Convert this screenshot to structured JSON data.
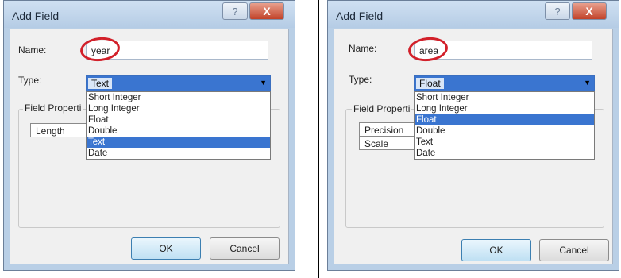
{
  "dialogs": [
    {
      "title": "Add Field",
      "help_glyph": "?",
      "close_glyph": "X",
      "name_label": "Name:",
      "name_value": "year",
      "type_label": "Type:",
      "type_value": "Text",
      "group_label": "Field Properti",
      "props": [
        "Length"
      ],
      "type_options": [
        "Short Integer",
        "Long Integer",
        "Float",
        "Double",
        "Text",
        "Date"
      ],
      "selected_option": "Text",
      "ok_label": "OK",
      "cancel_label": "Cancel"
    },
    {
      "title": "Add Field",
      "help_glyph": "?",
      "close_glyph": "X",
      "name_label": "Name:",
      "name_value": "area",
      "type_label": "Type:",
      "type_value": "Float",
      "group_label": "Field Properti",
      "props": [
        "Precision",
        "Scale"
      ],
      "type_options": [
        "Short Integer",
        "Long Integer",
        "Float",
        "Double",
        "Text",
        "Date"
      ],
      "selected_option": "Float",
      "ok_label": "OK",
      "cancel_label": "Cancel"
    }
  ],
  "colors": {
    "highlight_circle": "#d2202a",
    "selection": "#3a75d0"
  }
}
